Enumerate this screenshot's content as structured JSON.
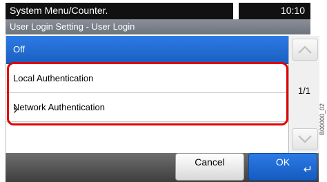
{
  "header": {
    "title": "System Menu/Counter.",
    "clock": "10:10"
  },
  "subtitle": "User Login Setting - User Login",
  "options": [
    {
      "label": "Off",
      "selected": true
    },
    {
      "label": "Local Authentication",
      "selected": false
    },
    {
      "label": "Network Authentication",
      "selected": false,
      "has_submenu": true
    }
  ],
  "scroll": {
    "page": "1/1"
  },
  "buttons": {
    "cancel": "Cancel",
    "ok": "OK"
  },
  "side_id": "B00000_02",
  "icons": {
    "up": "chevron-up-icon",
    "down": "chevron-down-icon",
    "enter": "enter-icon",
    "submenu": "chevron-right-icon"
  },
  "colors": {
    "selected": "#2c7be5",
    "highlight": "#e00000"
  }
}
